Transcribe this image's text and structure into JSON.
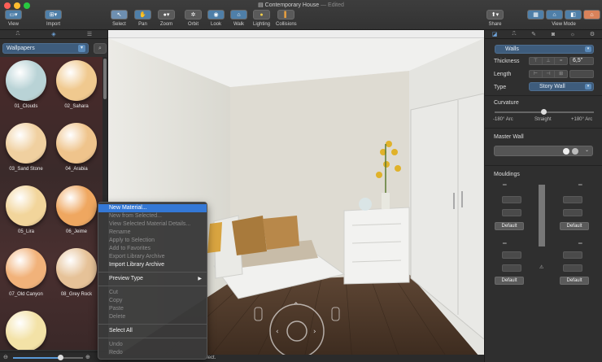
{
  "window": {
    "title": "Contemporary House",
    "edited": " — Edited",
    "traffic_colors": [
      "#fe5f57",
      "#febc2e",
      "#28c840"
    ]
  },
  "toolbar": {
    "view": "View",
    "import": "Import",
    "select": "Select",
    "pan": "Pan",
    "zoom": "Zoom",
    "orbit": "Orbit",
    "look": "Look",
    "walk": "Walk",
    "lighting": "Lighting",
    "collisions": "Collisions",
    "share": "Share",
    "view_mode": "View Mode"
  },
  "library": {
    "selected": "Wallpapers",
    "materials": [
      {
        "label": "01_Clouds",
        "color": "#b9d3d6"
      },
      {
        "label": "02_Sahara",
        "color": "#f0c98f"
      },
      {
        "label": "03_Sand Stone",
        "color": "#f0d0a0"
      },
      {
        "label": "04_Arabia",
        "color": "#efc48c"
      },
      {
        "label": "05_Lira",
        "color": "#f2d59b"
      },
      {
        "label": "06_Jeime",
        "color": "#efa760"
      },
      {
        "label": "07_Old Canyon",
        "color": "#f1b27a"
      },
      {
        "label": "08_Grey Rock",
        "color": "#e6c298"
      },
      {
        "label": "",
        "color": "#f3e2a7"
      }
    ],
    "zoom_level": 0.68
  },
  "context_menu": {
    "items": [
      {
        "label": "New Material...",
        "state": "highlight"
      },
      {
        "label": "New from Selected...",
        "state": "disabled"
      },
      {
        "label": "View Selected Material Details...",
        "state": "disabled"
      },
      {
        "label": "Rename",
        "state": "disabled"
      },
      {
        "label": "Apply to Selection",
        "state": "disabled"
      },
      {
        "label": "Add to Favorites",
        "state": "disabled"
      },
      {
        "label": "Export Library Archive",
        "state": "disabled"
      },
      {
        "label": "Import Library Archive",
        "state": "enabled"
      },
      {
        "label": "-",
        "state": "sep"
      },
      {
        "label": "Preview Type",
        "state": "submenu"
      },
      {
        "label": "-",
        "state": "sep"
      },
      {
        "label": "Cut",
        "state": "disabled"
      },
      {
        "label": "Copy",
        "state": "disabled"
      },
      {
        "label": "Paste",
        "state": "disabled"
      },
      {
        "label": "Delete",
        "state": "disabled"
      },
      {
        "label": "-",
        "state": "sep"
      },
      {
        "label": "Select All",
        "state": "enabled"
      },
      {
        "label": "-",
        "state": "sep"
      },
      {
        "label": "Undo",
        "state": "disabled"
      },
      {
        "label": "Redo",
        "state": "disabled"
      }
    ]
  },
  "status": "elect.",
  "inspector": {
    "object": "Walls",
    "thickness_label": "Thickness",
    "thickness_value": "6,5\"",
    "length_label": "Length",
    "type_label": "Type",
    "type_value": "Story Wall",
    "curvature_label": "Curvature",
    "curv_min": "-180° Arc",
    "curv_mid": "Straight",
    "curv_max": "+180° Arc",
    "master_wall_label": "Master Wall",
    "mouldings_label": "Mouldings",
    "default_1": "Default",
    "default_2": "Default",
    "default_3": "Default",
    "default_4": "Default"
  }
}
